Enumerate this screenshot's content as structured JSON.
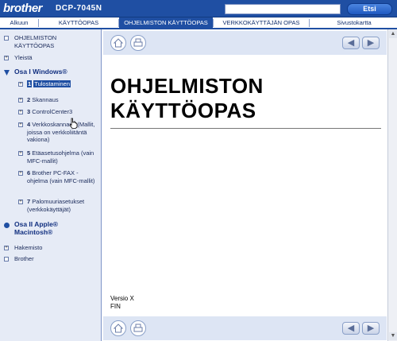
{
  "header": {
    "brand": "brother",
    "model": "DCP-7045N",
    "search_placeholder": "",
    "search_button": "Etsi"
  },
  "nav": [
    {
      "label": "Alkuun"
    },
    {
      "label": "KÄYTTÖOPAS"
    },
    {
      "label": "OHJELMISTON KÄYTTÖOPAS"
    },
    {
      "label": "VERKKOKÄYTTÄJÄN OPAS"
    },
    {
      "label": "Sivustokartta"
    }
  ],
  "sidebar": {
    "top_title": "OHJELMISTON KÄYTTÖOPAS",
    "yleista": "Yleistä",
    "part1": "Osa I Windows®",
    "items": [
      {
        "num": "1",
        "label": "Tulostaminen"
      },
      {
        "num": "2",
        "label": "Skannaus"
      },
      {
        "num": "3",
        "label": "ControlCenter3"
      },
      {
        "num": "4",
        "label": "Verkkoskannaus (Mallit, joissa on verkkoliitäntä vakiona)"
      },
      {
        "num": "5",
        "label": "Etäasetusohjelma (vain MFC-mallit)"
      },
      {
        "num": "6",
        "label": "Brother PC-FAX -ohjelma (vain MFC-mallit)"
      },
      {
        "num": "7",
        "label": "Palomuuriasetukset (verkkokäyttäjät)"
      }
    ],
    "part2": "Osa II Apple® Macintosh®",
    "hakemisto": "Hakemisto",
    "brother": "Brother"
  },
  "content": {
    "title_line1": "OHJELMISTON",
    "title_line2": "KÄYTTÖOPAS",
    "version": "Versio X",
    "language": "FIN"
  },
  "colors": {
    "brand_blue": "#1f4fa3",
    "sidebar_bg": "#e6ebf6",
    "toolbar_bg": "#dde5f4"
  }
}
